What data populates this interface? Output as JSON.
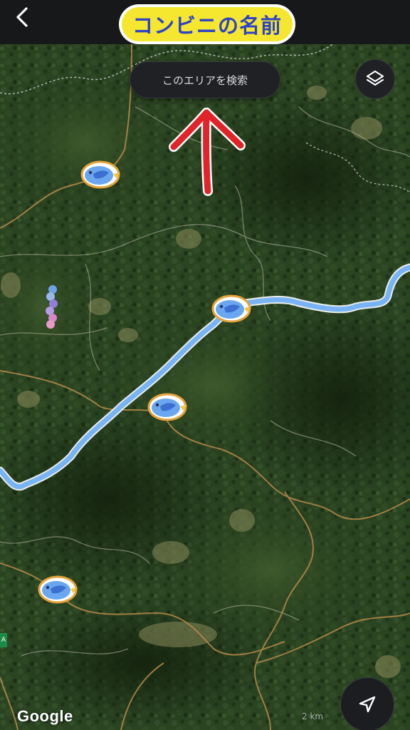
{
  "header": {
    "title": "コンビニの名前",
    "title_bg_color": "#f5e72f",
    "title_text_color": "#2f43c6",
    "back_icon": "chevron-left-icon"
  },
  "map": {
    "search_area_label": "このエリアを検索",
    "layers_icon": "layers-icon",
    "navigate_icon": "navigation-arrow-icon",
    "attribution": "Google",
    "scale_label": "2 km",
    "route_color": "#78b4f4",
    "annotation_arrow_color": "#e0242a",
    "marker_icon": "bluebird-icon",
    "side_tab_label": "A"
  }
}
